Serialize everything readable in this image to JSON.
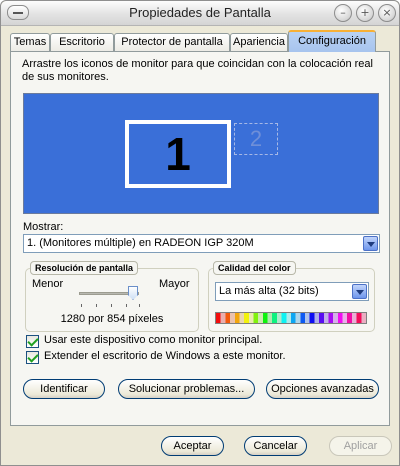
{
  "window": {
    "title": "Propiedades de Pantalla"
  },
  "icons": {
    "close": "close-icon",
    "minimize": "minimize-icon",
    "maximize": "maximize-icon",
    "system_menu": "system-menu-icon"
  },
  "tabs": [
    {
      "label": "Temas",
      "active": false
    },
    {
      "label": "Escritorio",
      "active": false
    },
    {
      "label": "Protector de pantalla",
      "active": false
    },
    {
      "label": "Apariencia",
      "active": false
    },
    {
      "label": "Configuración",
      "active": true
    }
  ],
  "instructions": "Arrastre los iconos de monitor para que coincidan con la colocación real de sus monitores.",
  "monitors": [
    {
      "number": "1",
      "primary": true
    },
    {
      "number": "2",
      "primary": false
    }
  ],
  "display": {
    "label": "Mostrar:",
    "value": "1. (Monitores múltiple) en RADEON IGP 320M"
  },
  "resolution": {
    "title": "Resolución de pantalla",
    "less_label": "Menor",
    "more_label": "Mayor",
    "value_text": "1280 por 854 píxeles",
    "slider_fraction": 0.9
  },
  "color_quality": {
    "title": "Calidad del color",
    "value": "La más alta (32 bits)"
  },
  "checkboxes": {
    "primary_monitor": {
      "label": "Usar este dispositivo como monitor principal.",
      "checked": true
    },
    "extend_desktop": {
      "label": "Extender el escritorio de Windows a este monitor.",
      "checked": true
    }
  },
  "buttons": {
    "identify": "Identificar",
    "troubleshoot": "Solucionar problemas...",
    "advanced": "Opciones avanzadas",
    "ok": "Aceptar",
    "cancel": "Cancelar",
    "apply": "Aplicar"
  },
  "colors": {
    "monitor_background": "#3a6fd8",
    "active_tab_accent": "#f7b035"
  }
}
